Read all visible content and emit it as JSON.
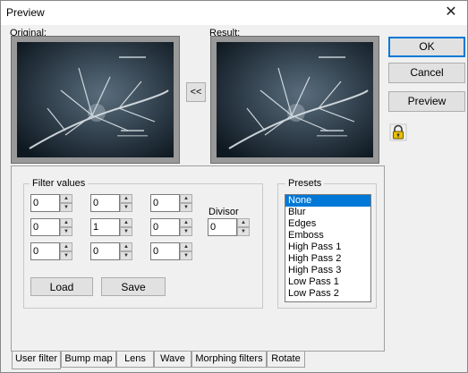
{
  "window": {
    "title": "Preview",
    "close_glyph": "✕"
  },
  "labels": {
    "original": "Original:",
    "result": "Result:"
  },
  "buttons": {
    "copy_back": "<<",
    "ok": "OK",
    "cancel": "Cancel",
    "preview": "Preview",
    "load": "Load",
    "save": "Save"
  },
  "filter_values": {
    "title": "Filter values",
    "matrix": [
      [
        "0",
        "0",
        "0"
      ],
      [
        "0",
        "1",
        "0"
      ],
      [
        "0",
        "0",
        "0"
      ]
    ],
    "divisor_label": "Divisor",
    "divisor": "0"
  },
  "presets": {
    "title": "Presets",
    "items": [
      "None",
      "Blur",
      "Edges",
      "Emboss",
      "High Pass 1",
      "High Pass 2",
      "High Pass 3",
      "Low Pass 1",
      "Low Pass 2"
    ],
    "selected": "None"
  },
  "tabs": [
    "User filter",
    "Bump map",
    "Lens",
    "Wave",
    "Morphing filters",
    "Rotate"
  ],
  "active_tab": "User filter",
  "icons": {
    "lock": "lock-icon",
    "close": "close-icon"
  },
  "colors": {
    "selection": "#0078d7",
    "button_face": "#e1e1e1",
    "dialog_bg": "#f0f0f0"
  }
}
